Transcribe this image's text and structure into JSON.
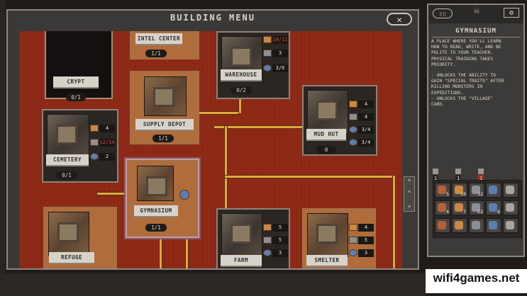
{
  "window": {
    "title": "BUILDING MENU",
    "close_icon": "crossed-swords-icon"
  },
  "buildings": [
    {
      "name": "INTEL CENTER",
      "count": "1/1"
    },
    {
      "name": "CRYPT",
      "count": "0/1"
    },
    {
      "name": "WAREHOUSE",
      "count": "0/2",
      "stats": [
        "10/11",
        "3",
        "3/6"
      ]
    },
    {
      "name": "SUPPLY DEPOT",
      "count": "1/1"
    },
    {
      "name": "MUD HUT",
      "count": "0",
      "stats": [
        "4",
        "4",
        "3/4",
        "3/4"
      ]
    },
    {
      "name": "CEMETERY",
      "count": "0/1",
      "stats": [
        "4",
        "12/14",
        "2"
      ]
    },
    {
      "name": "GYMNASIUM",
      "count": "1/1"
    },
    {
      "name": "REFUGE",
      "count": ""
    },
    {
      "name": "FARM",
      "count": "",
      "stats": [
        "5",
        "5",
        "3"
      ]
    },
    {
      "name": "SMELTER",
      "count": "",
      "stats": [
        "4",
        "5",
        "3"
      ]
    }
  ],
  "panel": {
    "title": "GYMNASIUM",
    "description": "A PLACE WHERE YOU'LL LEARN\nHOW TO READ, WRITE, AND BE\nPOLITE TO YOUR TEACHER.\nPHYSICAL TRAINING TAKES\nPRIORITY.",
    "unlocks": "- UNLOCKS THE ABILITY TO\nGAIN \"SPECIAL TRAITS\" AFTER\nKILLING MONSTERS IN\nEXPEDITIONS.\n- UNLOCKS THE \"VILLAGE\"\nCARD.",
    "chips": [
      "1",
      "1",
      "1"
    ],
    "inventory": [
      "5",
      "10",
      "12",
      "",
      "",
      "4",
      "7",
      "22",
      "6",
      "",
      "",
      "",
      "",
      "",
      ""
    ]
  },
  "watermark": "wifi4games.net",
  "colors": {
    "board": "#8e2a16",
    "path": "#dfaa3a",
    "frame": "#3b3937",
    "selected": "#c79aa5"
  }
}
